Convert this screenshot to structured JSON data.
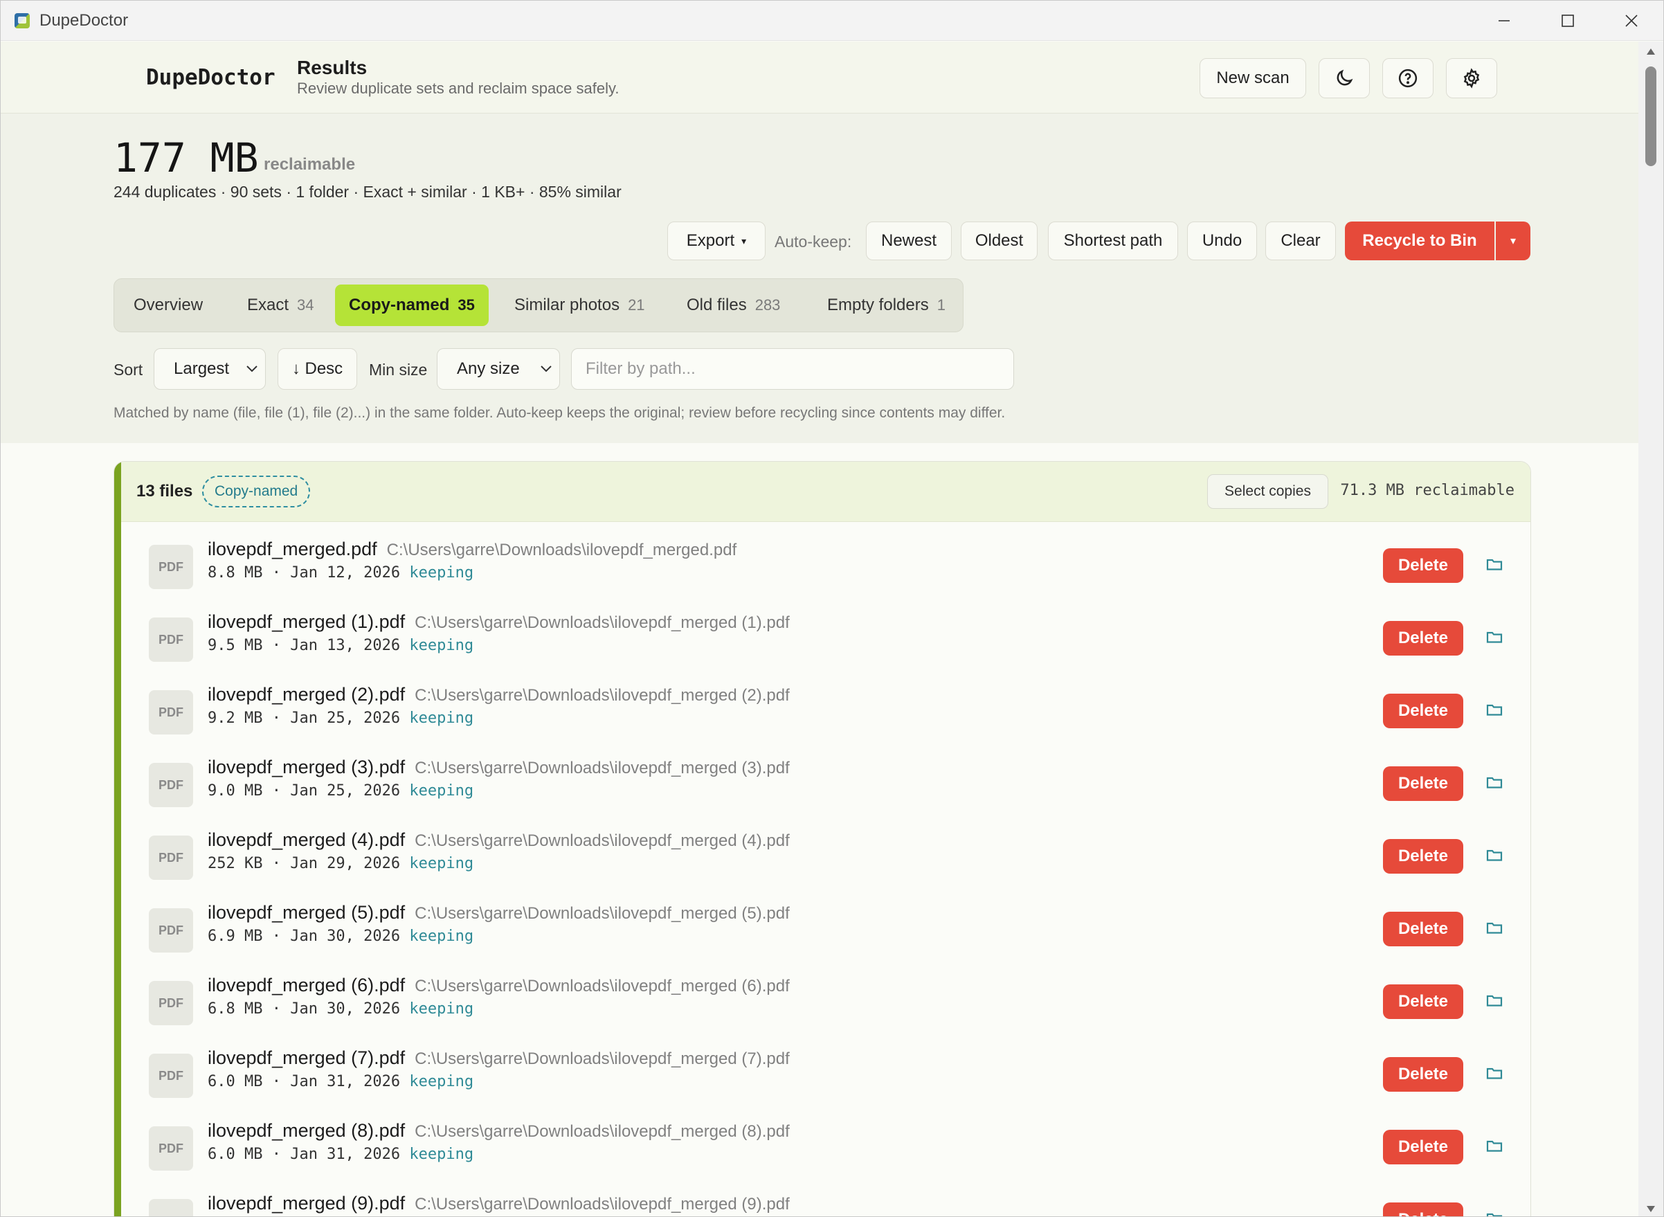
{
  "window": {
    "title": "DupeDoctor"
  },
  "header": {
    "brand": "DupeDoctor",
    "title": "Results",
    "subtitle": "Review duplicate sets and reclaim space safely.",
    "new_scan": "New scan"
  },
  "summary": {
    "size": "177 MB",
    "size_label": "reclaimable",
    "stats": "244 duplicates · 90 sets · 1 folder · Exact + similar · 1 KB+ · 85% similar"
  },
  "toolbar": {
    "export": "Export",
    "export_caret": "▾",
    "autokeep_label": "Auto-keep:",
    "newest": "Newest",
    "oldest": "Oldest",
    "shortest_path": "Shortest path",
    "undo": "Undo",
    "clear": "Clear",
    "recycle": "Recycle to Bin",
    "recycle_caret": "▾"
  },
  "tabs": [
    {
      "label": "Overview",
      "count": ""
    },
    {
      "label": "Exact",
      "count": "34"
    },
    {
      "label": "Copy-named",
      "count": "35"
    },
    {
      "label": "Similar photos",
      "count": "21"
    },
    {
      "label": "Old files",
      "count": "283"
    },
    {
      "label": "Empty folders",
      "count": "1"
    }
  ],
  "filters": {
    "sort_label": "Sort",
    "sort_value": "Largest",
    "direction": "↓ Desc",
    "min_size_label": "Min size",
    "min_size_value": "Any size",
    "filter_placeholder": "Filter by path..."
  },
  "note": "Matched by name (file, file (1), file (2)...) in the same folder. Auto-keep keeps the original; review before recycling since contents may differ.",
  "group": {
    "files_count": "13 files",
    "badge": "Copy-named",
    "select_copies": "Select copies",
    "reclaimable": "71.3 MB reclaimable",
    "accent_color": "#7aa320"
  },
  "files": [
    {
      "icon": "PDF",
      "name": "ilovepdf_merged.pdf",
      "path": "C:\\Users\\garre\\Downloads\\ilovepdf_merged.pdf",
      "meta": "8.8 MB · Jan 12, 2026",
      "status": "keeping",
      "action": "Delete"
    },
    {
      "icon": "PDF",
      "name": "ilovepdf_merged (1).pdf",
      "path": "C:\\Users\\garre\\Downloads\\ilovepdf_merged (1).pdf",
      "meta": "9.5 MB · Jan 13, 2026",
      "status": "keeping",
      "action": "Delete"
    },
    {
      "icon": "PDF",
      "name": "ilovepdf_merged (2).pdf",
      "path": "C:\\Users\\garre\\Downloads\\ilovepdf_merged (2).pdf",
      "meta": "9.2 MB · Jan 25, 2026",
      "status": "keeping",
      "action": "Delete"
    },
    {
      "icon": "PDF",
      "name": "ilovepdf_merged (3).pdf",
      "path": "C:\\Users\\garre\\Downloads\\ilovepdf_merged (3).pdf",
      "meta": "9.0 MB · Jan 25, 2026",
      "status": "keeping",
      "action": "Delete"
    },
    {
      "icon": "PDF",
      "name": "ilovepdf_merged (4).pdf",
      "path": "C:\\Users\\garre\\Downloads\\ilovepdf_merged (4).pdf",
      "meta": "252 KB · Jan 29, 2026",
      "status": "keeping",
      "action": "Delete"
    },
    {
      "icon": "PDF",
      "name": "ilovepdf_merged (5).pdf",
      "path": "C:\\Users\\garre\\Downloads\\ilovepdf_merged (5).pdf",
      "meta": "6.9 MB · Jan 30, 2026",
      "status": "keeping",
      "action": "Delete"
    },
    {
      "icon": "PDF",
      "name": "ilovepdf_merged (6).pdf",
      "path": "C:\\Users\\garre\\Downloads\\ilovepdf_merged (6).pdf",
      "meta": "6.8 MB · Jan 30, 2026",
      "status": "keeping",
      "action": "Delete"
    },
    {
      "icon": "PDF",
      "name": "ilovepdf_merged (7).pdf",
      "path": "C:\\Users\\garre\\Downloads\\ilovepdf_merged (7).pdf",
      "meta": "6.0 MB · Jan 31, 2026",
      "status": "keeping",
      "action": "Delete"
    },
    {
      "icon": "PDF",
      "name": "ilovepdf_merged (8).pdf",
      "path": "C:\\Users\\garre\\Downloads\\ilovepdf_merged (8).pdf",
      "meta": "6.0 MB · Jan 31, 2026",
      "status": "keeping",
      "action": "Delete"
    },
    {
      "icon": "PDF",
      "name": "ilovepdf_merged (9).pdf",
      "path": "C:\\Users\\garre\\Downloads\\ilovepdf_merged (9).pdf",
      "meta": "",
      "status": "",
      "action": "Delete"
    }
  ],
  "colors": {
    "accent_green": "#b5e337",
    "danger": "#e64a3a",
    "teal": "#2f8a96"
  }
}
